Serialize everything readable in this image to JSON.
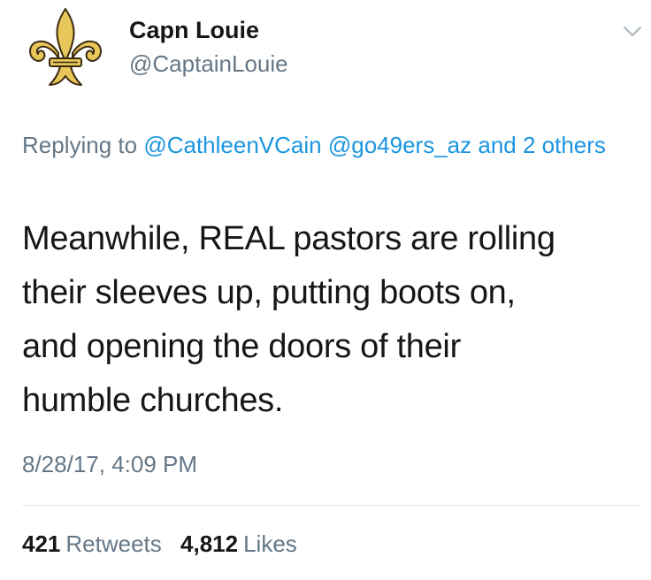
{
  "user": {
    "display_name": "Capn Louie",
    "handle": "@CaptainLouie",
    "avatar_icon": "fleur-de-lis-icon"
  },
  "menu": {
    "icon": "chevron-down-icon"
  },
  "reply": {
    "prefix": "Replying to ",
    "mentions": [
      "@CathleenVCain",
      "@go49ers_az"
    ],
    "others_text": "and 2 others"
  },
  "tweet": {
    "lines": [
      "Meanwhile, REAL pastors are rolling",
      "their sleeves up, putting boots on,",
      "and opening the doors of their",
      "humble churches."
    ],
    "timestamp": "8/28/17, 4:09 PM"
  },
  "stats": {
    "retweets_count": "421",
    "retweets_label": "Retweets",
    "likes_count": "4,812",
    "likes_label": "Likes"
  },
  "colors": {
    "link": "#1b95e0",
    "secondary": "#657786",
    "text": "#14171a",
    "gold": "#e8c75a",
    "divider": "#e1e8ed"
  }
}
